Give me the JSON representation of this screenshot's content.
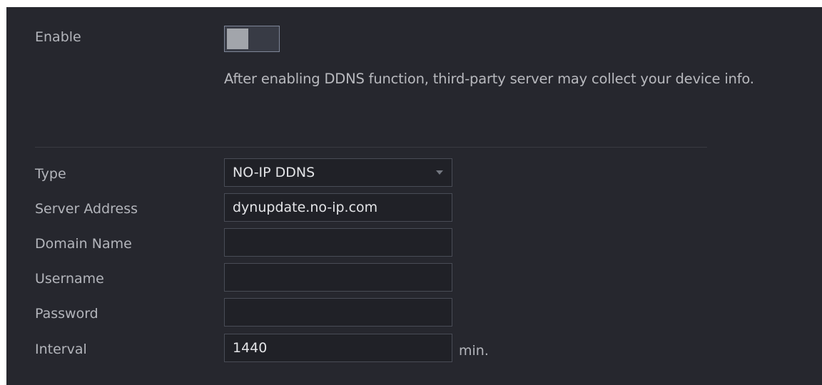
{
  "enable": {
    "label": "Enable",
    "state": "off"
  },
  "notice": "After enabling DDNS function, third-party server may collect your device info.",
  "form": {
    "type": {
      "label": "Type",
      "value": "NO-IP DDNS"
    },
    "server_address": {
      "label": "Server Address",
      "value": "dynupdate.no-ip.com"
    },
    "domain_name": {
      "label": "Domain Name",
      "value": ""
    },
    "username": {
      "label": "Username",
      "value": ""
    },
    "password": {
      "label": "Password",
      "value": ""
    },
    "interval": {
      "label": "Interval",
      "value": "1440",
      "unit": "min."
    }
  },
  "colors": {
    "background": "#26272e",
    "field_background": "#202127",
    "field_border": "#494c56",
    "label_text": "#b3b5bb",
    "value_text": "#e3e4e7"
  }
}
